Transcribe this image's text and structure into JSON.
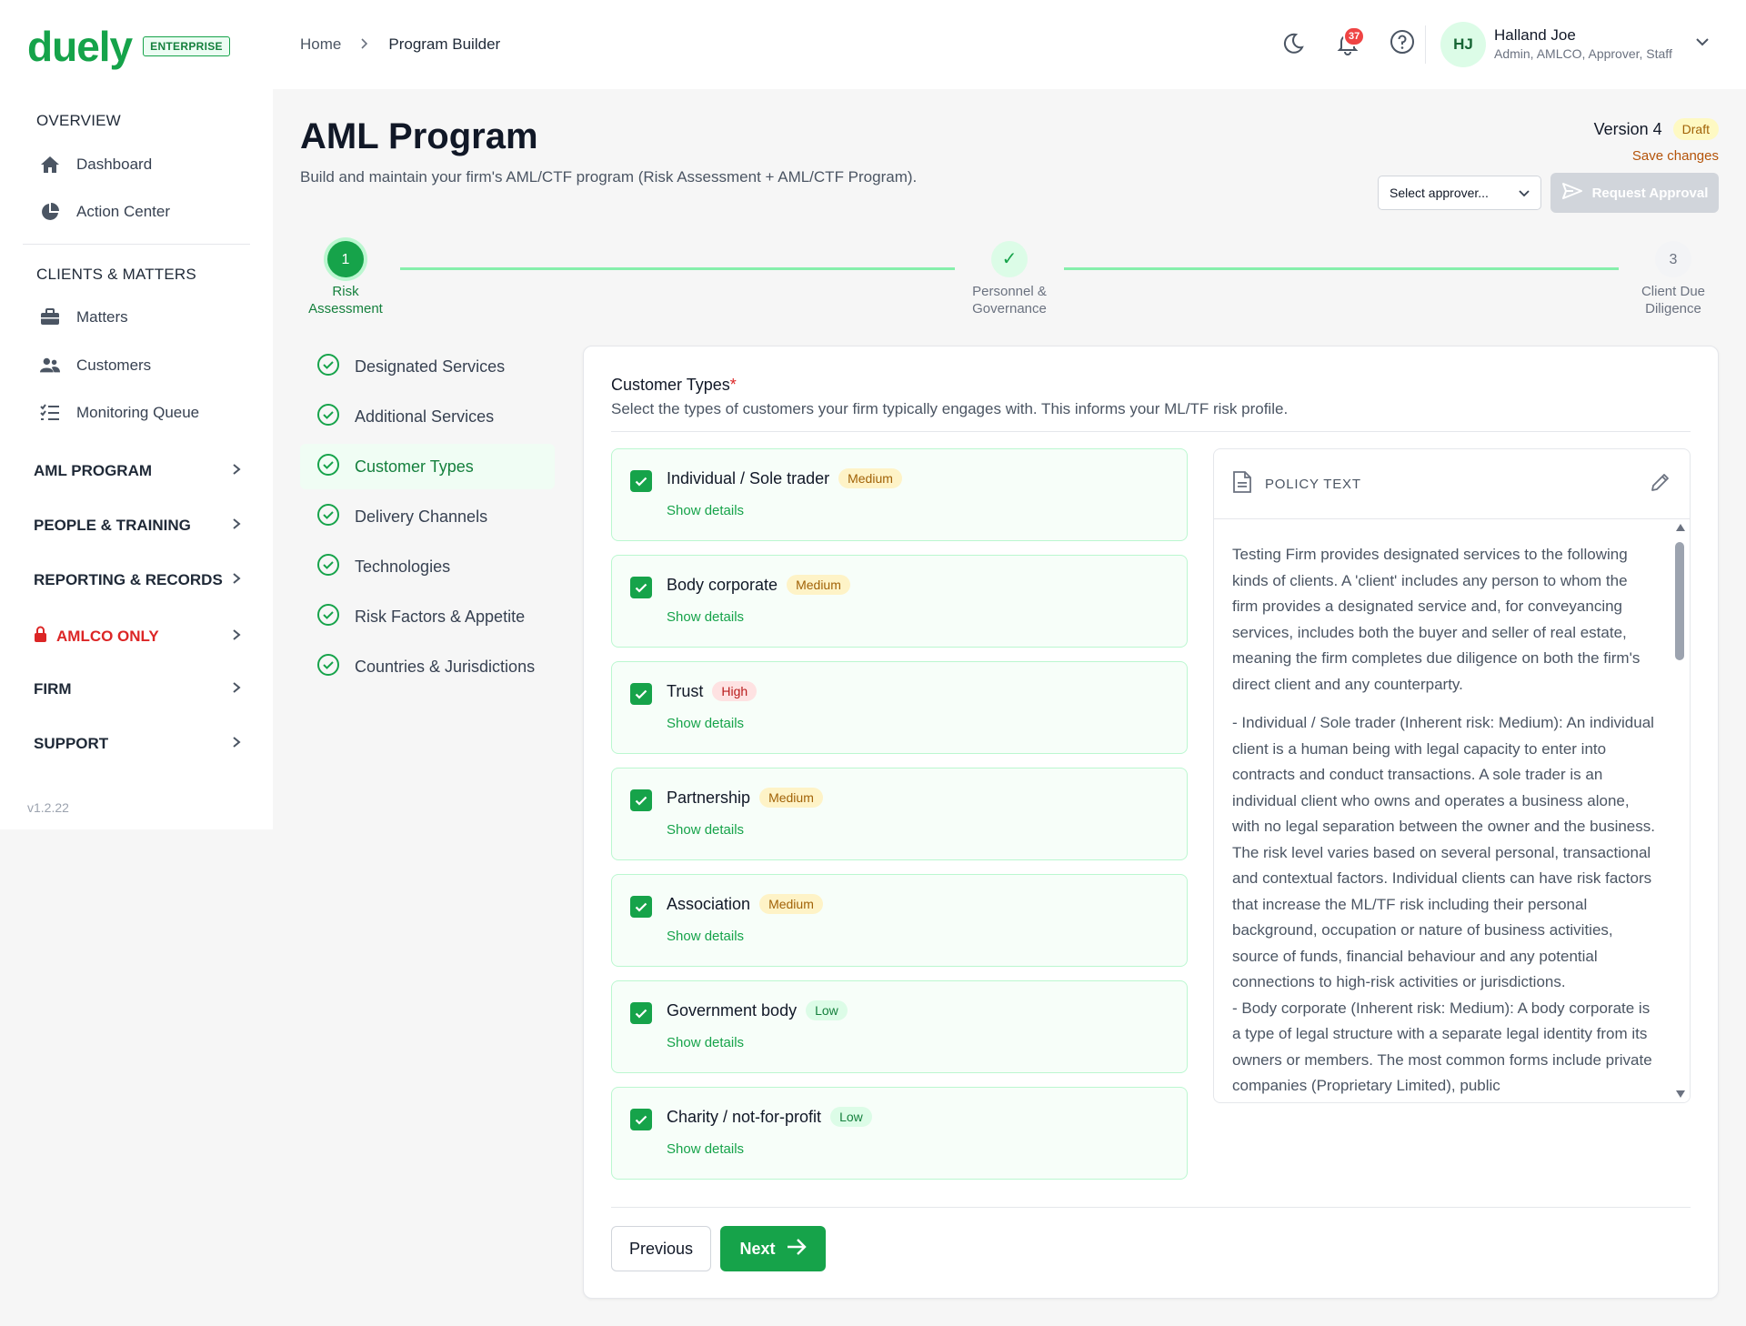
{
  "brand": {
    "logo": "duely",
    "edition": "ENTERPRISE"
  },
  "sidebar": {
    "overview_title": "OVERVIEW",
    "overview_items": [
      {
        "label": "Dashboard",
        "icon": "home-icon"
      },
      {
        "label": "Action Center",
        "icon": "pie-chart-icon"
      }
    ],
    "clients_title": "CLIENTS & MATTERS",
    "clients_items": [
      {
        "label": "Matters",
        "icon": "briefcase-icon"
      },
      {
        "label": "Customers",
        "icon": "users-icon"
      },
      {
        "label": "Monitoring Queue",
        "icon": "list-check-icon"
      }
    ],
    "groups": [
      {
        "label": "AML PROGRAM"
      },
      {
        "label": "PEOPLE & TRAINING"
      },
      {
        "label": "REPORTING & RECORDS"
      },
      {
        "label": "AMLCO ONLY",
        "color": "#dc2626",
        "icon": "lock-icon"
      },
      {
        "label": "FIRM"
      },
      {
        "label": "SUPPORT"
      }
    ],
    "version": "v1.2.22"
  },
  "breadcrumb": {
    "home": "Home",
    "current": "Program Builder"
  },
  "header": {
    "notifications": "37",
    "user_initials": "HJ",
    "user_name": "Halland Joe",
    "user_roles": "Admin, AMLCO, Approver, Staff"
  },
  "page": {
    "title": "AML Program",
    "subtitle": "Build and maintain your firm's AML/CTF program (Risk Assessment + AML/CTF Program).",
    "version_label": "Version 4",
    "status": "Draft",
    "save_changes": "Save changes",
    "approver_placeholder": "Select approver...",
    "request_approval": "Request Approval"
  },
  "steps": [
    {
      "number": "1",
      "line1": "Risk",
      "line2": "Assessment",
      "state": "current"
    },
    {
      "number": "✓",
      "line1": "Personnel &",
      "line2": "Governance",
      "state": "done"
    },
    {
      "number": "3",
      "line1": "Client Due",
      "line2": "Diligence",
      "state": "todo"
    }
  ],
  "substeps": [
    "Designated Services",
    "Additional Services",
    "Customer Types",
    "Delivery Channels",
    "Technologies",
    "Risk Factors & Appetite",
    "Countries & Jurisdictions"
  ],
  "section": {
    "title": "Customer Types",
    "required_mark": "*",
    "description": "Select the types of customers your firm typically engages with. This informs your ML/TF risk profile.",
    "show_details": "Show details",
    "customer_types": [
      {
        "label": "Individual / Sole trader",
        "risk": "Medium",
        "checked": true
      },
      {
        "label": "Body corporate",
        "risk": "Medium",
        "checked": true
      },
      {
        "label": "Trust",
        "risk": "High",
        "checked": true
      },
      {
        "label": "Partnership",
        "risk": "Medium",
        "checked": true
      },
      {
        "label": "Association",
        "risk": "Medium",
        "checked": true
      },
      {
        "label": "Government body",
        "risk": "Low",
        "checked": true
      },
      {
        "label": "Charity / not-for-profit",
        "risk": "Low",
        "checked": true
      }
    ]
  },
  "policy": {
    "heading": "POLICY TEXT",
    "para1": "Testing Firm provides designated services to the following kinds of clients. A 'client' includes any person to whom the firm provides a designated service and, for conveyancing services, includes both the buyer and seller of real estate, meaning the firm completes due diligence on both the firm's direct client and any counterparty.",
    "para2": "- Individual / Sole trader (Inherent risk: Medium): An individual client is a human being with legal capacity to enter into contracts and conduct transactions. A sole trader is an individual client who owns and operates a business alone, with no legal separation between the owner and the business. The risk level varies based on several personal, transactional and contextual factors. Individual clients can have risk factors that increase the ML/TF risk including their personal background, occupation or nature of business activities, source of funds, financial behaviour and any potential connections to high-risk activities or jurisdictions.",
    "para3": "- Body corporate (Inherent risk: Medium): A body corporate is a type of legal structure with a separate legal identity from its owners or members. The most common forms include private companies (Proprietary Limited), public"
  },
  "footer": {
    "previous": "Previous",
    "next": "Next"
  },
  "colors": {
    "accent": "#16a34a",
    "medium": "#a16207",
    "high": "#b91c1c",
    "low": "#15803d"
  }
}
